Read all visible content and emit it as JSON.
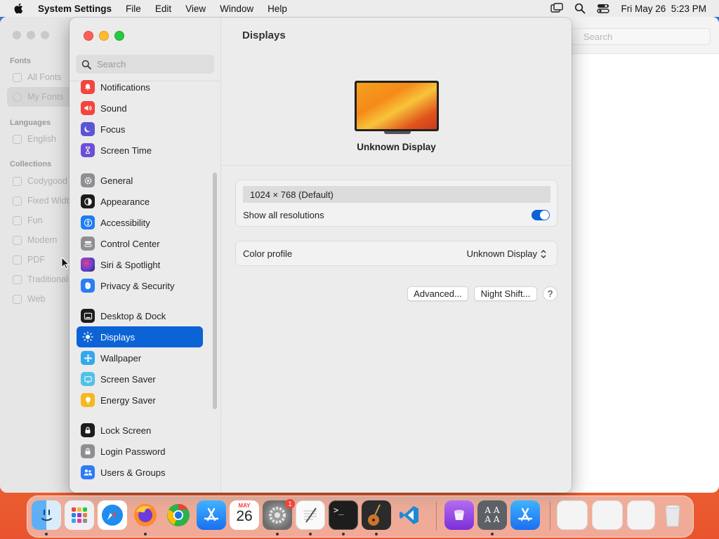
{
  "menubar": {
    "app_name": "System Settings",
    "menus": [
      "File",
      "Edit",
      "View",
      "Window",
      "Help"
    ],
    "clock": "Fri May 26  5:23 PM"
  },
  "fontbook": {
    "search_placeholder": "Search",
    "sections": [
      {
        "heading": "Fonts",
        "items": [
          "All Fonts",
          "My Fonts"
        ]
      },
      {
        "heading": "Languages",
        "items": [
          "English"
        ]
      },
      {
        "heading": "Collections",
        "items": [
          "Codygood",
          "Fixed Width",
          "Fun",
          "Modern",
          "PDF",
          "Traditional",
          "Web"
        ]
      }
    ]
  },
  "settings": {
    "search_placeholder": "Search",
    "sidebar_groups": [
      [
        {
          "label": "Notifications",
          "icon": "bell-icon",
          "color": "#f2453d"
        },
        {
          "label": "Sound",
          "icon": "speaker-icon",
          "color": "#f2453d"
        },
        {
          "label": "Focus",
          "icon": "moon-icon",
          "color": "#5b55d6"
        },
        {
          "label": "Screen Time",
          "icon": "hourglass-icon",
          "color": "#6c4fd8"
        }
      ],
      [
        {
          "label": "General",
          "icon": "gear-icon",
          "color": "#8e8e93"
        },
        {
          "label": "Appearance",
          "icon": "appearance-icon",
          "color": "#1c1c1e"
        },
        {
          "label": "Accessibility",
          "icon": "accessibility-icon",
          "color": "#1f7cf2"
        },
        {
          "label": "Control Center",
          "icon": "control-center-icon",
          "color": "#8e8e93"
        },
        {
          "label": "Siri & Spotlight",
          "icon": "siri-icon",
          "color": "#7b3fd1"
        },
        {
          "label": "Privacy & Security",
          "icon": "hand-icon",
          "color": "#2c7cf6"
        }
      ],
      [
        {
          "label": "Desktop & Dock",
          "icon": "dock-icon",
          "color": "#1c1c1e"
        },
        {
          "label": "Displays",
          "icon": "sun-icon",
          "color": "#1f7cf2",
          "active": true
        },
        {
          "label": "Wallpaper",
          "icon": "wallpaper-icon",
          "color": "#35a8ea"
        },
        {
          "label": "Screen Saver",
          "icon": "screensaver-icon",
          "color": "#52c0e8"
        },
        {
          "label": "Energy Saver",
          "icon": "battery-icon",
          "color": "#f6b821"
        }
      ],
      [
        {
          "label": "Lock Screen",
          "icon": "lock-icon",
          "color": "#1c1c1e"
        },
        {
          "label": "Login Password",
          "icon": "login-password-icon",
          "color": "#8e8e93"
        },
        {
          "label": "Users & Groups",
          "icon": "users-icon",
          "color": "#2c7cf6"
        }
      ]
    ],
    "content": {
      "title": "Displays",
      "display_name": "Unknown Display",
      "resolution": "1024 × 768 (Default)",
      "show_all_resolutions_label": "Show all resolutions",
      "show_all_resolutions": true,
      "color_profile_label": "Color profile",
      "color_profile_value": "Unknown Display",
      "advanced_button": "Advanced...",
      "night_shift_button": "Night Shift...",
      "help_button": "?"
    }
  },
  "dock": {
    "apps": [
      {
        "name": "Finder",
        "icon": "finder-icon",
        "running": true
      },
      {
        "name": "Launchpad",
        "icon": "launchpad-icon",
        "running": false
      },
      {
        "name": "Safari",
        "icon": "safari-icon",
        "running": false
      },
      {
        "name": "Firefox",
        "icon": "firefox-icon",
        "running": true
      },
      {
        "name": "Chrome",
        "icon": "chrome-icon",
        "running": false
      },
      {
        "name": "App Store",
        "icon": "app-store-icon",
        "running": false
      },
      {
        "name": "Calendar",
        "icon": "calendar-icon",
        "running": false,
        "month": "MAY",
        "day": "26"
      },
      {
        "name": "System Settings",
        "icon": "system-settings-icon",
        "running": true,
        "badge": "1"
      },
      {
        "name": "TextEdit",
        "icon": "textedit-icon",
        "running": true
      },
      {
        "name": "Terminal",
        "icon": "terminal-icon",
        "running": true
      },
      {
        "name": "GarageBand",
        "icon": "guitar-icon",
        "running": true
      },
      {
        "name": "VS Code",
        "icon": "vscode-icon",
        "running": false
      },
      {
        "name": "Podcast app",
        "icon": "purple-app-icon",
        "running": false
      },
      {
        "name": "Font Book",
        "icon": "font-book-icon",
        "running": true
      },
      {
        "name": "App Store (recent)",
        "icon": "app-store-icon",
        "running": false
      }
    ]
  }
}
